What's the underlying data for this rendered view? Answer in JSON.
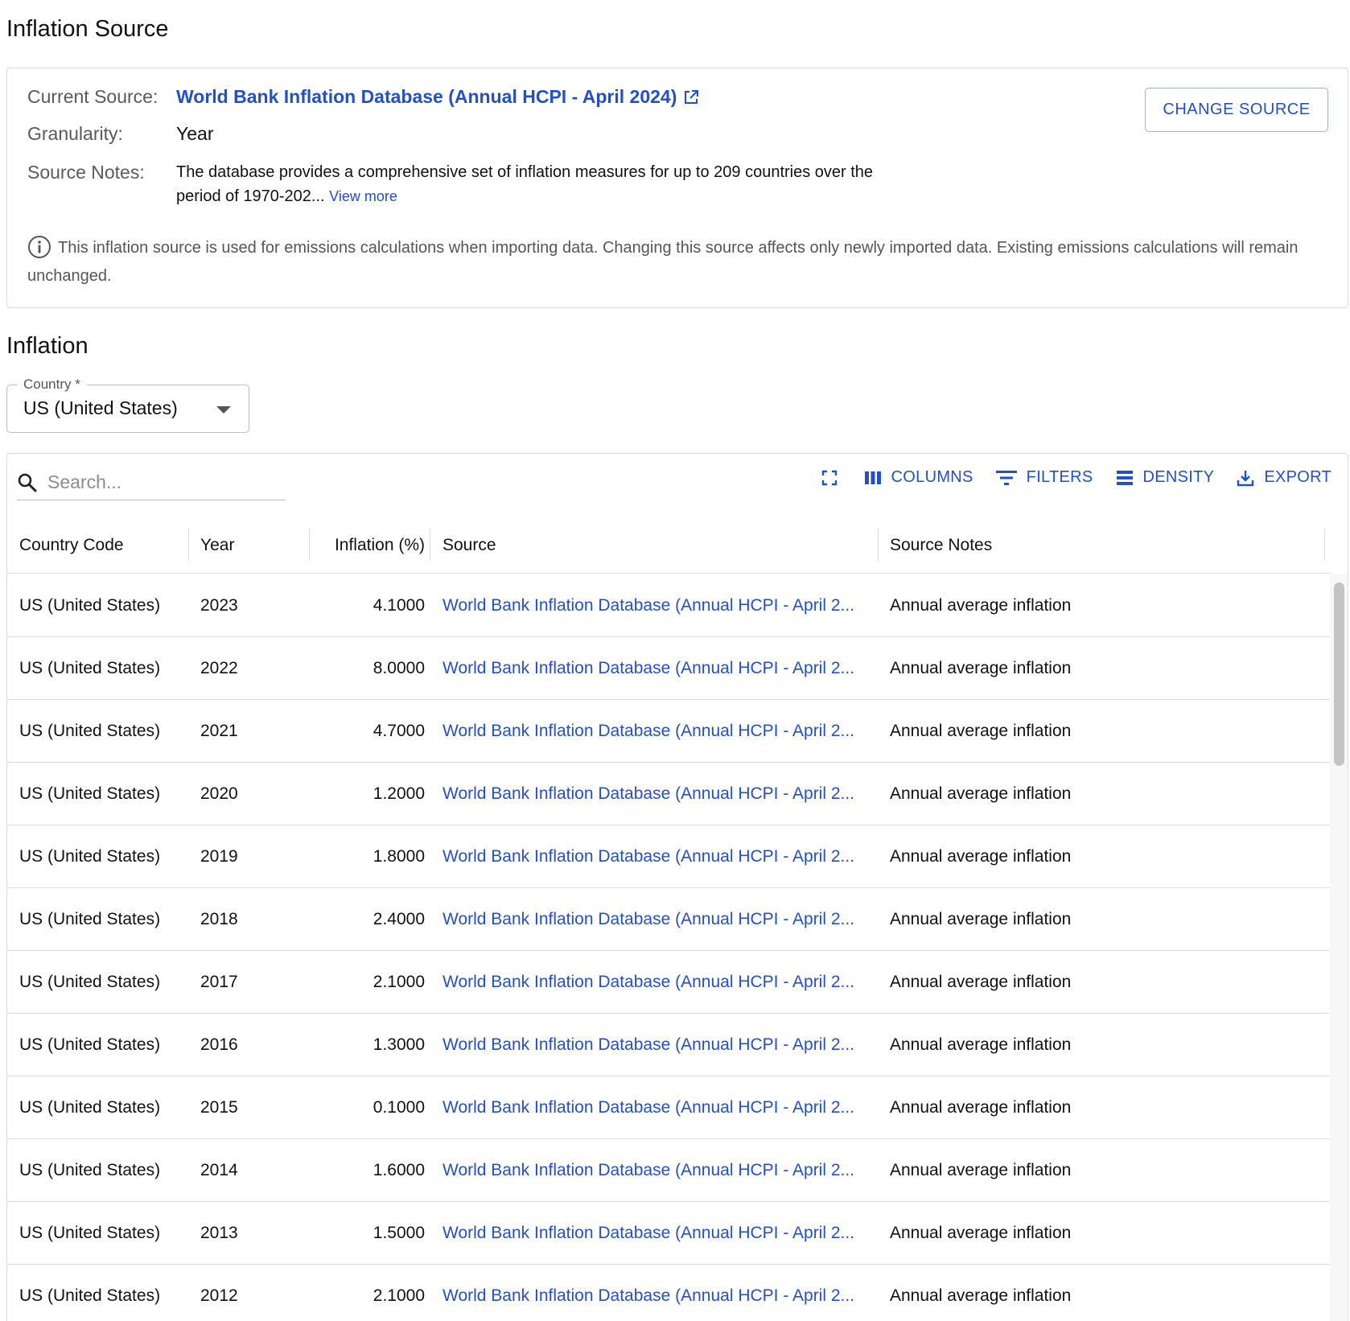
{
  "source_section": {
    "title": "Inflation Source",
    "current_source_label": "Current Source:",
    "current_source_value": "World Bank Inflation Database (Annual HCPI - April 2024)",
    "granularity_label": "Granularity:",
    "granularity_value": "Year",
    "source_notes_label": "Source Notes:",
    "source_notes_value": "The database provides a comprehensive set of inflation measures for up to 209 countries over the period of 1970-202...",
    "view_more_label": "View more",
    "change_source_label": "CHANGE SOURCE",
    "info_text": "This inflation source is used for emissions calculations when importing data. Changing this source affects only newly imported data. Existing emissions calculations will remain unchanged."
  },
  "inflation_section": {
    "title": "Inflation",
    "country_select": {
      "label": "Country *",
      "value": "US (United States)"
    }
  },
  "grid": {
    "search_placeholder": "Search...",
    "toolbar": {
      "columns_label": "COLUMNS",
      "filters_label": "FILTERS",
      "density_label": "DENSITY",
      "export_label": "EXPORT"
    },
    "columns": [
      "Country Code",
      "Year",
      "Inflation (%)",
      "Source",
      "Source Notes"
    ],
    "rows": [
      {
        "country": "US (United States)",
        "year": "2023",
        "inflation": "4.1000",
        "source": "World Bank Inflation Database (Annual HCPI - April 2...",
        "notes": "Annual average inflation"
      },
      {
        "country": "US (United States)",
        "year": "2022",
        "inflation": "8.0000",
        "source": "World Bank Inflation Database (Annual HCPI - April 2...",
        "notes": "Annual average inflation"
      },
      {
        "country": "US (United States)",
        "year": "2021",
        "inflation": "4.7000",
        "source": "World Bank Inflation Database (Annual HCPI - April 2...",
        "notes": "Annual average inflation"
      },
      {
        "country": "US (United States)",
        "year": "2020",
        "inflation": "1.2000",
        "source": "World Bank Inflation Database (Annual HCPI - April 2...",
        "notes": "Annual average inflation"
      },
      {
        "country": "US (United States)",
        "year": "2019",
        "inflation": "1.8000",
        "source": "World Bank Inflation Database (Annual HCPI - April 2...",
        "notes": "Annual average inflation"
      },
      {
        "country": "US (United States)",
        "year": "2018",
        "inflation": "2.4000",
        "source": "World Bank Inflation Database (Annual HCPI - April 2...",
        "notes": "Annual average inflation"
      },
      {
        "country": "US (United States)",
        "year": "2017",
        "inflation": "2.1000",
        "source": "World Bank Inflation Database (Annual HCPI - April 2...",
        "notes": "Annual average inflation"
      },
      {
        "country": "US (United States)",
        "year": "2016",
        "inflation": "1.3000",
        "source": "World Bank Inflation Database (Annual HCPI - April 2...",
        "notes": "Annual average inflation"
      },
      {
        "country": "US (United States)",
        "year": "2015",
        "inflation": "0.1000",
        "source": "World Bank Inflation Database (Annual HCPI - April 2...",
        "notes": "Annual average inflation"
      },
      {
        "country": "US (United States)",
        "year": "2014",
        "inflation": "1.6000",
        "source": "World Bank Inflation Database (Annual HCPI - April 2...",
        "notes": "Annual average inflation"
      },
      {
        "country": "US (United States)",
        "year": "2013",
        "inflation": "1.5000",
        "source": "World Bank Inflation Database (Annual HCPI - April 2...",
        "notes": "Annual average inflation"
      },
      {
        "country": "US (United States)",
        "year": "2012",
        "inflation": "2.1000",
        "source": "World Bank Inflation Database (Annual HCPI - April 2...",
        "notes": "Annual average inflation"
      }
    ]
  },
  "icons": {
    "external_link": "external-link-icon",
    "info": "info-icon",
    "search": "search-icon",
    "fullscreen": "fullscreen-icon",
    "columns": "columns-icon",
    "filters": "filter-icon",
    "density": "density-icon",
    "export": "export-icon",
    "dropdown": "caret-down-icon"
  },
  "colors": {
    "accent": "#2350c8",
    "border": "#dcdcdc",
    "muted_text": "#5a5a5a"
  }
}
